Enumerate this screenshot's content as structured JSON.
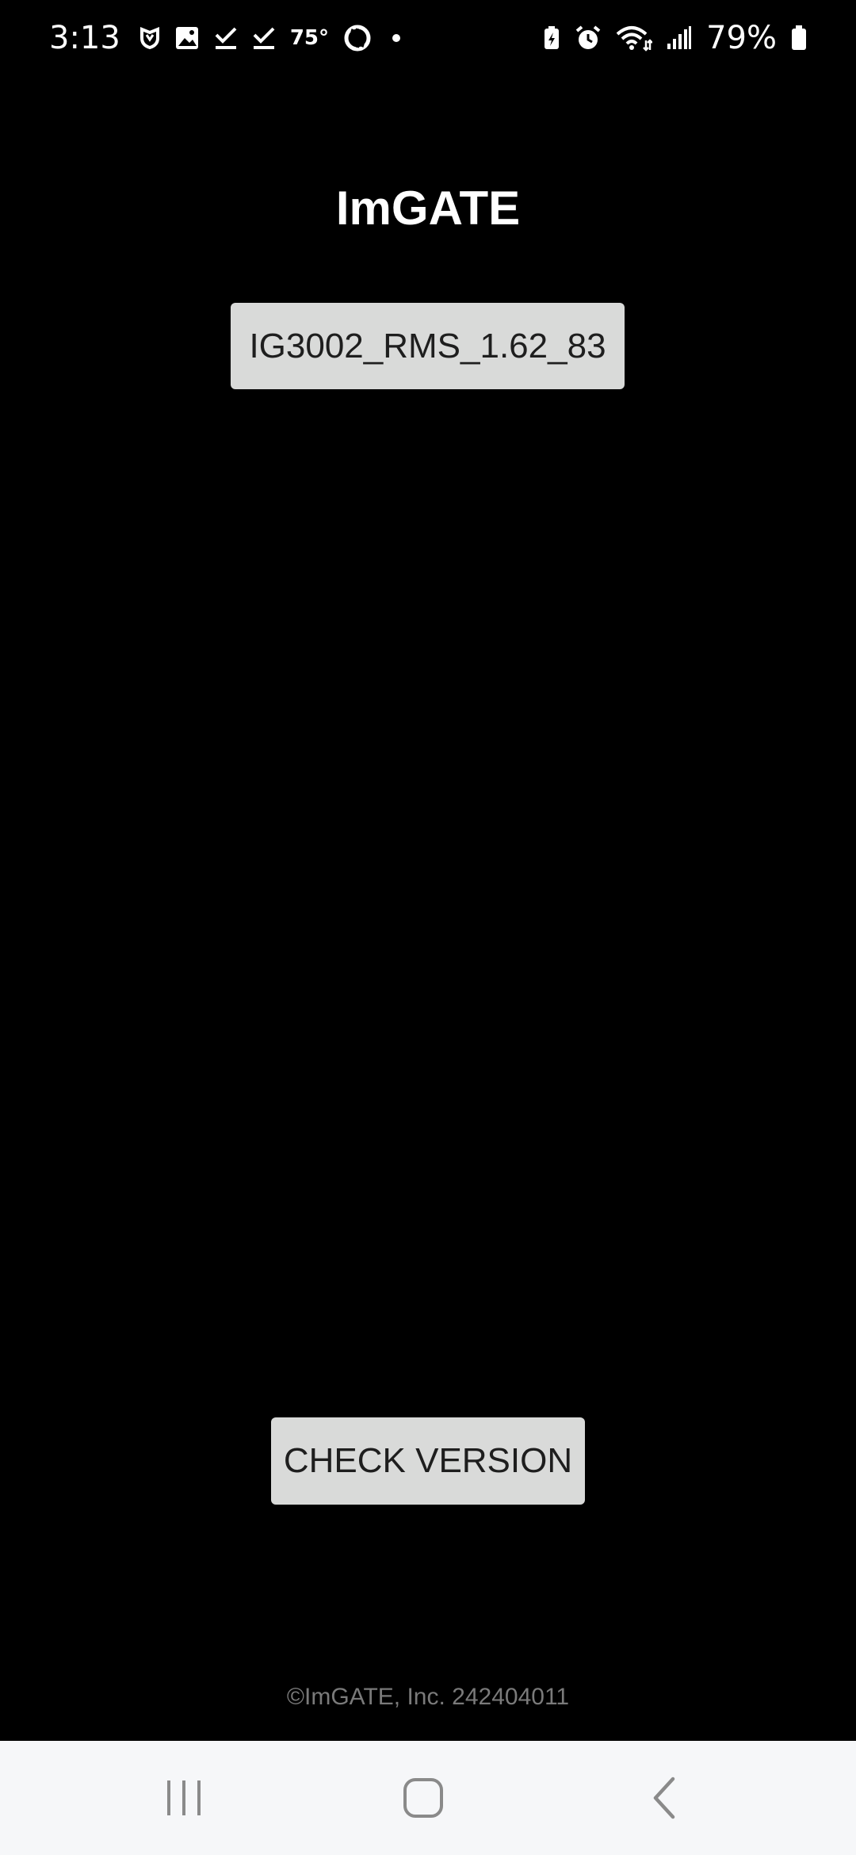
{
  "status_bar": {
    "time": "3:13",
    "temperature": "75°",
    "battery_percent": "79%",
    "left_icons": [
      "shield-icon",
      "gallery-icon",
      "check-icon",
      "check-icon",
      "sync-icon",
      "notification-dot-icon"
    ],
    "right_icons": [
      "battery-saver-icon",
      "alarm-icon",
      "wifi-icon",
      "signal-icon",
      "battery-icon"
    ]
  },
  "app": {
    "title": "ImGATE",
    "version_value": "IG3002_RMS_1.62_83",
    "check_button_label": "CHECK VERSION",
    "copyright": "©ImGATE, Inc. 242404011"
  },
  "nav_bar": {
    "buttons": [
      "recent-apps",
      "home",
      "back"
    ]
  },
  "colors": {
    "background": "#000000",
    "text_primary": "#ffffff",
    "button_bg": "#d9dad9",
    "button_text": "#1e1e1e",
    "copyright_text": "#7a7a7a",
    "nav_bg": "#f6f7f9",
    "nav_icon": "#8a8a8a"
  }
}
